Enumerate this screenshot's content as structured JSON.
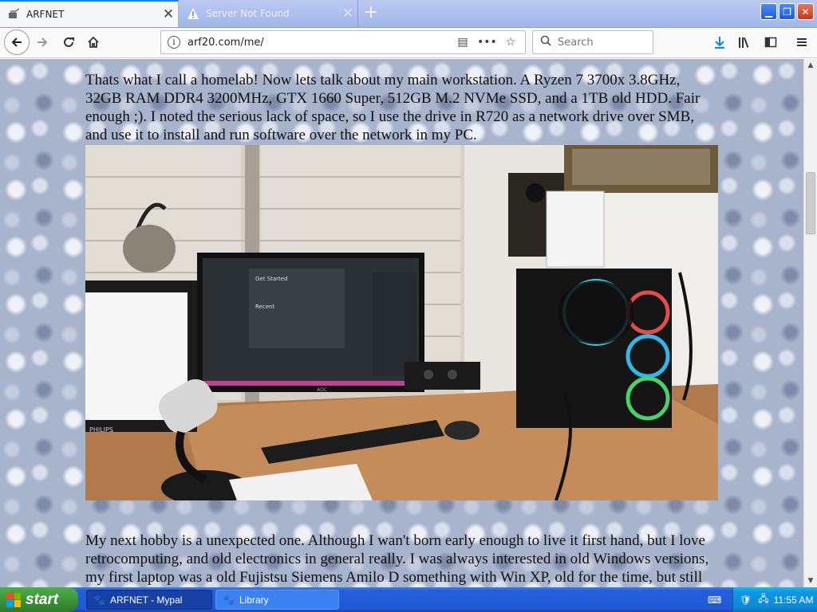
{
  "browser": {
    "tabs": [
      {
        "title": "ARFNET",
        "active": true
      },
      {
        "title": "Server Not Found",
        "active": false
      }
    ],
    "url": "arf20.com/me/",
    "search_placeholder": "Search"
  },
  "page": {
    "paragraph_1": "Thats what I call a homelab! Now lets talk about my main workstation. A Ryzen 7 3700x 3.8GHz, 32GB RAM DDR4 3200MHz, GTX 1660 Super, 512GB M.2 NVMe SSD, and a 1TB old HDD. Fair enough ;). I noted the serious lack of space, so I use the drive in R720 as a network drive over SMB, and use it to install and run software over the network in my PC.",
    "paragraph_2": "My next hobby is a unexpected one. Although I wan't born early enough to live it first hand, but I love retrocomputing, and old electronics in general really. I was always interested in old Windows versions, my first laptop was a old Fujistsu Siemens Amilo D something with Win XP, old for the time, but still worked for what I wanted to do, learn BATCH and BASIC. Then I discovered VMs,",
    "photo_monitor_text": {
      "get_started": "Get Started",
      "recent": "Recent",
      "brand_philips": "PHILIPS",
      "brand_aoc": "AOC"
    }
  },
  "taskbar": {
    "start_label": "start",
    "tasks": [
      {
        "label": "ARFNET - Mypal"
      },
      {
        "label": "Library"
      }
    ],
    "clock": "11:55 AM"
  },
  "colors": {
    "tab_accent": "#0a84ff",
    "taskbar_blue": "#245edb",
    "start_green": "#3a8f36",
    "tray_blue": "#0f96e2"
  }
}
